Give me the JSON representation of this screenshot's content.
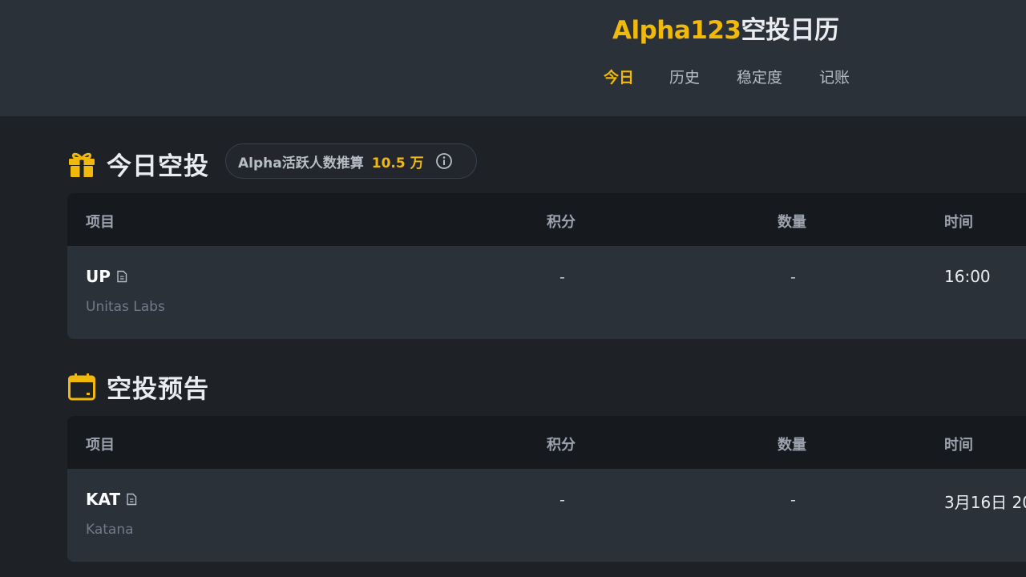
{
  "header": {
    "title_brand": "Alpha123",
    "title_rest": "空投日历",
    "nav": [
      {
        "label": "今日",
        "active": true
      },
      {
        "label": "历史",
        "active": false
      },
      {
        "label": "稳定度",
        "active": false
      },
      {
        "label": "记账",
        "active": false
      }
    ]
  },
  "today": {
    "title": "今日空投",
    "icon": "gift-icon",
    "badge": {
      "label": "Alpha活跃人数推算",
      "value": "10.5 万",
      "icon": "info-icon"
    },
    "columns": [
      "项目",
      "积分",
      "数量",
      "时间"
    ],
    "rows": [
      {
        "symbol": "UP",
        "name": "Unitas Labs",
        "points": "-",
        "amount": "-",
        "time": "16:00"
      }
    ]
  },
  "upcoming": {
    "title": "空投预告",
    "icon": "calendar-icon",
    "columns": [
      "项目",
      "积分",
      "数量",
      "时间"
    ],
    "rows": [
      {
        "symbol": "KAT",
        "name": "Katana",
        "points": "-",
        "amount": "-",
        "time": "3月16日 20"
      }
    ]
  },
  "colors": {
    "accent": "#f0b90b",
    "header_bg": "#2b3139",
    "page_bg": "#1e2126",
    "table_head_bg": "#16191d"
  }
}
